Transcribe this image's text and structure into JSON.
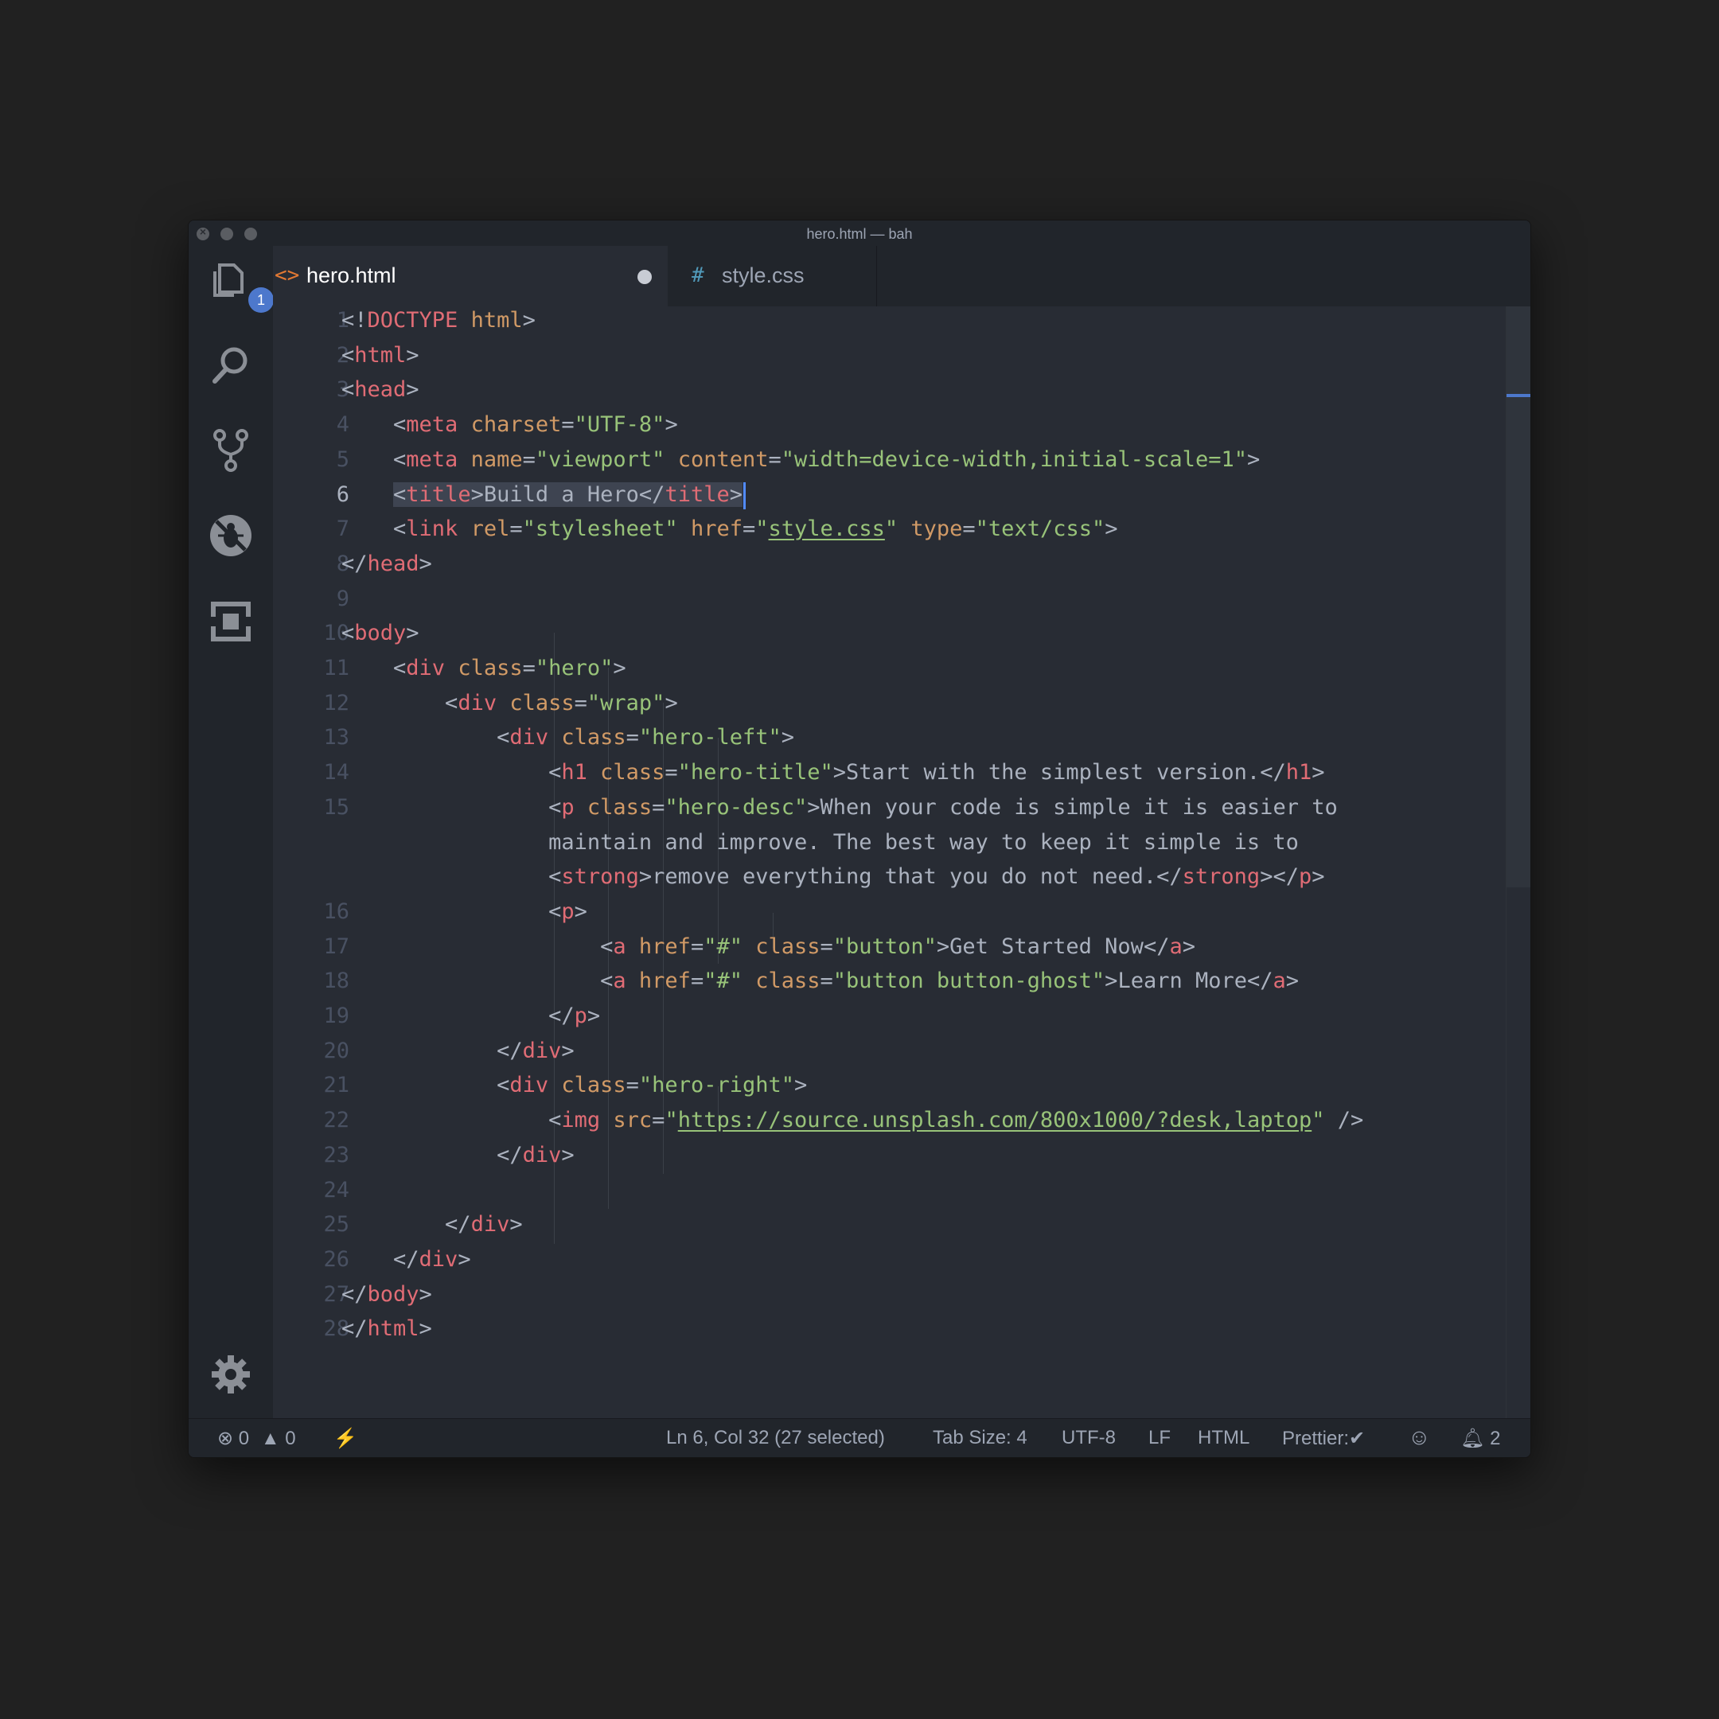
{
  "window": {
    "title": "hero.html — bah"
  },
  "activity_bar": {
    "explorer_badge": "1"
  },
  "tabs": [
    {
      "icon": "<>",
      "label": "hero.html",
      "dirty": true,
      "active": true,
      "icon_color": "#e37933"
    },
    {
      "icon": "#",
      "label": "style.css",
      "dirty": false,
      "active": false,
      "icon_color": "#519aba"
    }
  ],
  "editor": {
    "active_line": 6,
    "line_numbers": [
      "1",
      "2",
      "3",
      "4",
      "5",
      "6",
      "7",
      "8",
      "9",
      "10",
      "11",
      "12",
      "13",
      "14",
      "15",
      "16",
      "17",
      "18",
      "19",
      "20",
      "21",
      "22",
      "23",
      "24",
      "25",
      "26",
      "27",
      "28"
    ]
  },
  "code": {
    "l1": {
      "a": "<!",
      "b": "DOCTYPE",
      "c": " ",
      "d": "html",
      "e": ">"
    },
    "l2": {
      "a": "<",
      "b": "html",
      "c": ">"
    },
    "l3": {
      "a": "<",
      "b": "head",
      "c": ">"
    },
    "l4": {
      "a": "    <",
      "b": "meta",
      "c": " ",
      "d": "charset",
      "e": "=",
      "f": "\"UTF-8\"",
      "g": ">"
    },
    "l5": {
      "a": "    <",
      "b": "meta",
      "c": " ",
      "d": "name",
      "e": "=",
      "f": "\"viewport\"",
      "g": " ",
      "h": "content",
      "i": "=",
      "j": "\"width=device-width,initial-scale=1\"",
      "k": ">"
    },
    "l6": {
      "indent": "    ",
      "a": "<",
      "b": "title",
      "c": ">",
      "d": "Build a Hero",
      "e": "</",
      "f": "title",
      "g": ">"
    },
    "l7": {
      "a": "    <",
      "b": "link",
      "c": " ",
      "d": "rel",
      "e": "=",
      "f": "\"stylesheet\"",
      "g": " ",
      "h": "href",
      "i": "=",
      "j": "\"",
      "k": "style.css",
      "l": "\"",
      "m": " ",
      "n": "type",
      "o": "=",
      "p": "\"text/css\"",
      "q": ">"
    },
    "l8": {
      "a": "</",
      "b": "head",
      "c": ">"
    },
    "l10": {
      "a": "<",
      "b": "body",
      "c": ">"
    },
    "l11": {
      "a": "    <",
      "b": "div",
      "c": " ",
      "d": "class",
      "e": "=",
      "f": "\"hero\"",
      "g": ">"
    },
    "l12": {
      "a": "        <",
      "b": "div",
      "c": " ",
      "d": "class",
      "e": "=",
      "f": "\"wrap\"",
      "g": ">"
    },
    "l13": {
      "a": "            <",
      "b": "div",
      "c": " ",
      "d": "class",
      "e": "=",
      "f": "\"hero-left\"",
      "g": ">"
    },
    "l14": {
      "a": "                <",
      "b": "h1",
      "c": " ",
      "d": "class",
      "e": "=",
      "f": "\"hero-title\"",
      "g": ">",
      "h": "Start with the simplest version.",
      "i": "</",
      "j": "h1",
      "k": ">"
    },
    "l15a": {
      "a": "                <",
      "b": "p",
      "c": " ",
      "d": "class",
      "e": "=",
      "f": "\"hero-desc\"",
      "g": ">",
      "h": "When your code is simple it is easier to"
    },
    "l15b": {
      "a": "                maintain and improve. The best way to keep it simple is to"
    },
    "l15c": {
      "a": "                <",
      "b": "strong",
      "c": ">",
      "d": "remove everything that you do not need.",
      "e": "</",
      "f": "strong",
      "g": "></",
      "h": "p",
      "i": ">"
    },
    "l16": {
      "a": "                <",
      "b": "p",
      "c": ">"
    },
    "l17": {
      "a": "                    <",
      "b": "a",
      "c": " ",
      "d": "href",
      "e": "=",
      "f": "\"#\"",
      "g": " ",
      "h": "class",
      "i": "=",
      "j": "\"button\"",
      "k": ">",
      "l": "Get Started Now",
      "m": "</",
      "n": "a",
      "o": ">"
    },
    "l18": {
      "a": "                    <",
      "b": "a",
      "c": " ",
      "d": "href",
      "e": "=",
      "f": "\"#\"",
      "g": " ",
      "h": "class",
      "i": "=",
      "j": "\"button button-ghost\"",
      "k": ">",
      "l": "Learn More",
      "m": "</",
      "n": "a",
      "o": ">"
    },
    "l19": {
      "a": "                </",
      "b": "p",
      "c": ">"
    },
    "l20": {
      "a": "            </",
      "b": "div",
      "c": ">"
    },
    "l21": {
      "a": "            <",
      "b": "div",
      "c": " ",
      "d": "class",
      "e": "=",
      "f": "\"hero-right\"",
      "g": ">"
    },
    "l22": {
      "a": "                <",
      "b": "img",
      "c": " ",
      "d": "src",
      "e": "=",
      "f": "\"",
      "g": "https://source.unsplash.com/800x1000/?desk,laptop",
      "h": "\"",
      "i": " />"
    },
    "l23": {
      "a": "            </",
      "b": "div",
      "c": ">"
    },
    "l25": {
      "a": "        </",
      "b": "div",
      "c": ">"
    },
    "l26": {
      "a": "    </",
      "b": "div",
      "c": ">"
    },
    "l27": {
      "a": "</",
      "b": "body",
      "c": ">"
    },
    "l28": {
      "a": "</",
      "b": "html",
      "c": ">"
    }
  },
  "status": {
    "errors": "0",
    "warnings": "0",
    "position": "Ln 6, Col 32 (27 selected)",
    "tab_size": "Tab Size: 4",
    "encoding": "UTF-8",
    "eol": "LF",
    "language": "HTML",
    "prettier": "Prettier:",
    "notifications": "2"
  },
  "colors": {
    "tag": "#e06c75",
    "attribute": "#d19a66",
    "string": "#98c379",
    "punctuation": "#abb2bf",
    "accent": "#4d78cc"
  }
}
